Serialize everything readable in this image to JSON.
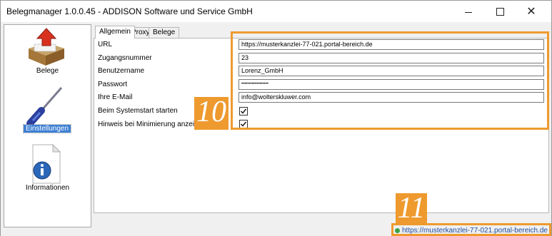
{
  "window": {
    "title": "Belegmanager 1.0.0.45 - ADDISON Software und Service GmbH",
    "close_glyph": "✕"
  },
  "sidebar": {
    "items": [
      {
        "label": "Belege",
        "icon": "document-upload-icon"
      },
      {
        "label": "Einstellungen",
        "icon": "screwdriver-icon",
        "selected": true
      },
      {
        "label": "Informationen",
        "icon": "info-icon"
      }
    ]
  },
  "tabs": [
    {
      "label": "Allgemein",
      "active": true
    },
    {
      "label": "Proxy"
    },
    {
      "label": "Belege"
    }
  ],
  "form": {
    "fields": [
      {
        "label": "URL",
        "value": "https://musterkanzlei-77-021.portal-bereich.de"
      },
      {
        "label": "Zugangsnummer",
        "value": "23"
      },
      {
        "label": "Benutzername",
        "value": "Lorenz_GmbH"
      },
      {
        "label": "Passwort",
        "value": "••••••••••••••••••"
      },
      {
        "label": "Ihre E-Mail",
        "value": "info@wolterskluwer.com"
      }
    ],
    "checkboxes": [
      {
        "label": "Beim Systemstart starten",
        "checked": true
      },
      {
        "label": "Hinweis bei Minimierung anzeigen",
        "checked": true
      }
    ]
  },
  "callouts": [
    {
      "number": "10"
    },
    {
      "number": "11"
    }
  ],
  "status": {
    "url": "https://musterkanzlei-77-021.portal-bereich.de",
    "indicator_color": "#3aa34a"
  },
  "colors": {
    "highlight": "#ee9a2e",
    "selection": "#3d7fd4"
  }
}
